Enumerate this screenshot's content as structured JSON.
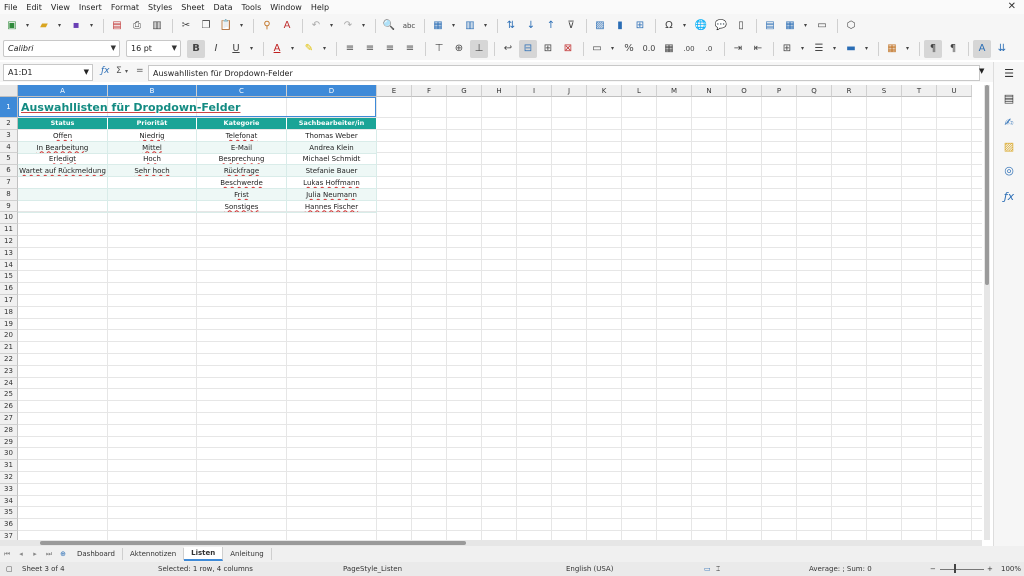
{
  "menu": [
    "File",
    "Edit",
    "View",
    "Insert",
    "Format",
    "Styles",
    "Sheet",
    "Data",
    "Tools",
    "Window",
    "Help"
  ],
  "font": {
    "name": "Calibri",
    "size": "16 pt"
  },
  "formula_bar": {
    "cell_ref": "A1:D1",
    "sigma": "Σ",
    "equals": "=",
    "content": "Auswahllisten für Dropdown-Felder"
  },
  "columns": [
    "A",
    "B",
    "C",
    "D",
    "E",
    "F",
    "G",
    "H",
    "I",
    "J",
    "K",
    "L",
    "M",
    "N",
    "O",
    "P",
    "Q",
    "R",
    "S",
    "T",
    "U"
  ],
  "rows": [
    "1",
    "2",
    "3",
    "4",
    "5",
    "6",
    "7",
    "8",
    "9",
    "10",
    "11",
    "12",
    "13",
    "14",
    "15",
    "16",
    "17",
    "18",
    "19",
    "20",
    "21",
    "22",
    "23",
    "24",
    "25",
    "26",
    "27",
    "28",
    "29",
    "30",
    "31",
    "32",
    "33",
    "34",
    "35",
    "36",
    "37"
  ],
  "sheet": {
    "title": "Auswahllisten für Dropdown-Felder",
    "headers": [
      "Status",
      "Priorität",
      "Kategorie",
      "Sachbearbeiter/in"
    ],
    "data": [
      [
        "Offen",
        "Niedrig",
        "Telefonat",
        "Thomas Weber"
      ],
      [
        "In Bearbeitung",
        "Mittel",
        "E-Mail",
        "Andrea Klein"
      ],
      [
        "Erledigt",
        "Hoch",
        "Besprechung",
        "Michael Schmidt"
      ],
      [
        "Wartet auf Rückmeldung",
        "Sehr hoch",
        "Rückfrage",
        "Stefanie Bauer"
      ],
      [
        "",
        "",
        "Beschwerde",
        "Lukas Hoffmann"
      ],
      [
        "",
        "",
        "Frist",
        "Julia Neumann"
      ],
      [
        "",
        "",
        "Sonstiges",
        "Hannes Fischer"
      ]
    ]
  },
  "tabs": [
    "Dashboard",
    "Aktennotizen",
    "Listen",
    "Anleitung"
  ],
  "active_tab": "Listen",
  "status": {
    "sheet": "Sheet 3 of 4",
    "selection": "Selected: 1 row, 4 columns",
    "page_style": "PageStyle_Listen",
    "language": "English (USA)",
    "summary": "Average: ; Sum: 0",
    "zoom": "100%"
  },
  "colors": {
    "accent": "#3e8ad8",
    "header_bg": "#1aa497",
    "title_text": "#138b82",
    "alt_row": "#eef8f6"
  }
}
